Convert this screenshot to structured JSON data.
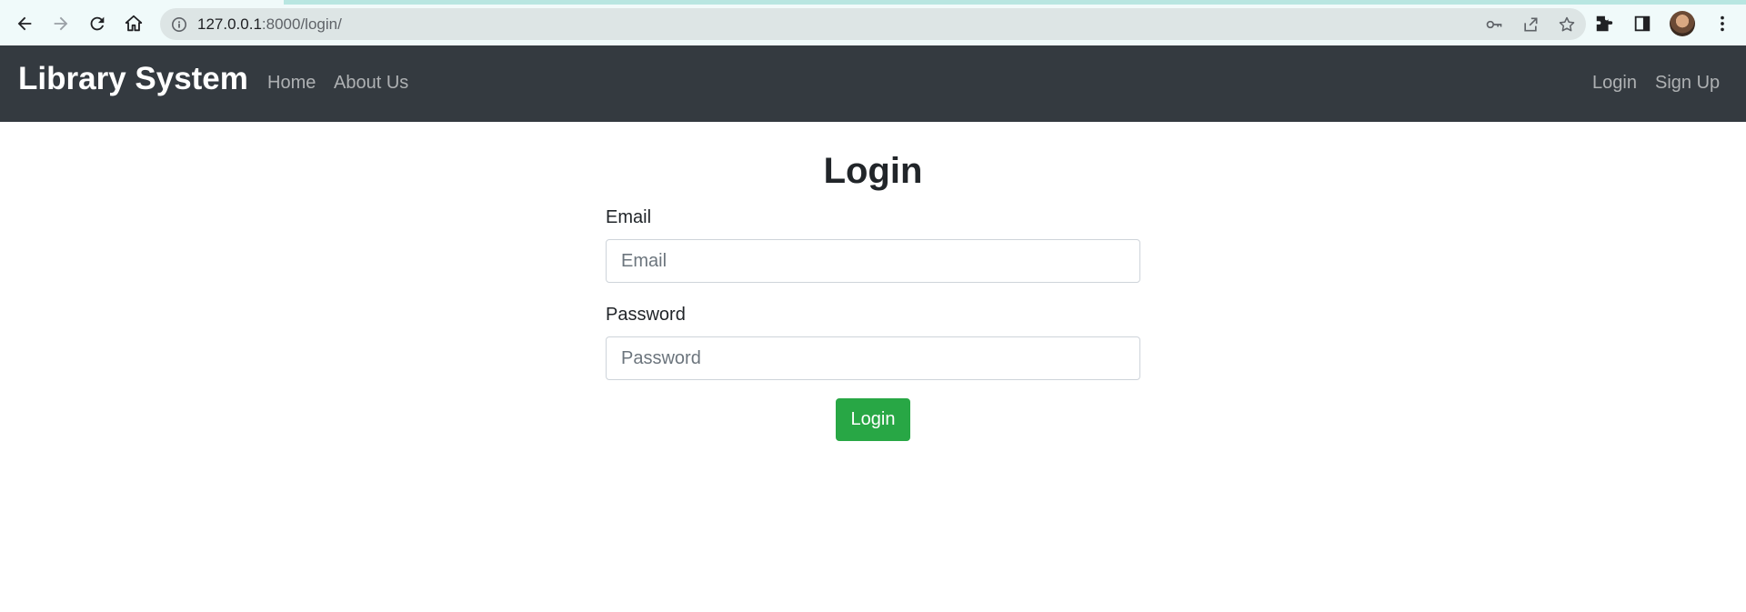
{
  "browser": {
    "url_host": "127.0.0.1",
    "url_rest": ":8000/login/"
  },
  "navbar": {
    "brand": "Library System",
    "left_links": [
      "Home",
      "About Us"
    ],
    "right_links": [
      "Login",
      "Sign Up"
    ]
  },
  "login_form": {
    "title": "Login",
    "email_label": "Email",
    "email_placeholder": "Email",
    "password_label": "Password",
    "password_placeholder": "Password",
    "submit_label": "Login"
  },
  "colors": {
    "navbar_bg": "#343a40",
    "submit_bg": "#28a745"
  }
}
